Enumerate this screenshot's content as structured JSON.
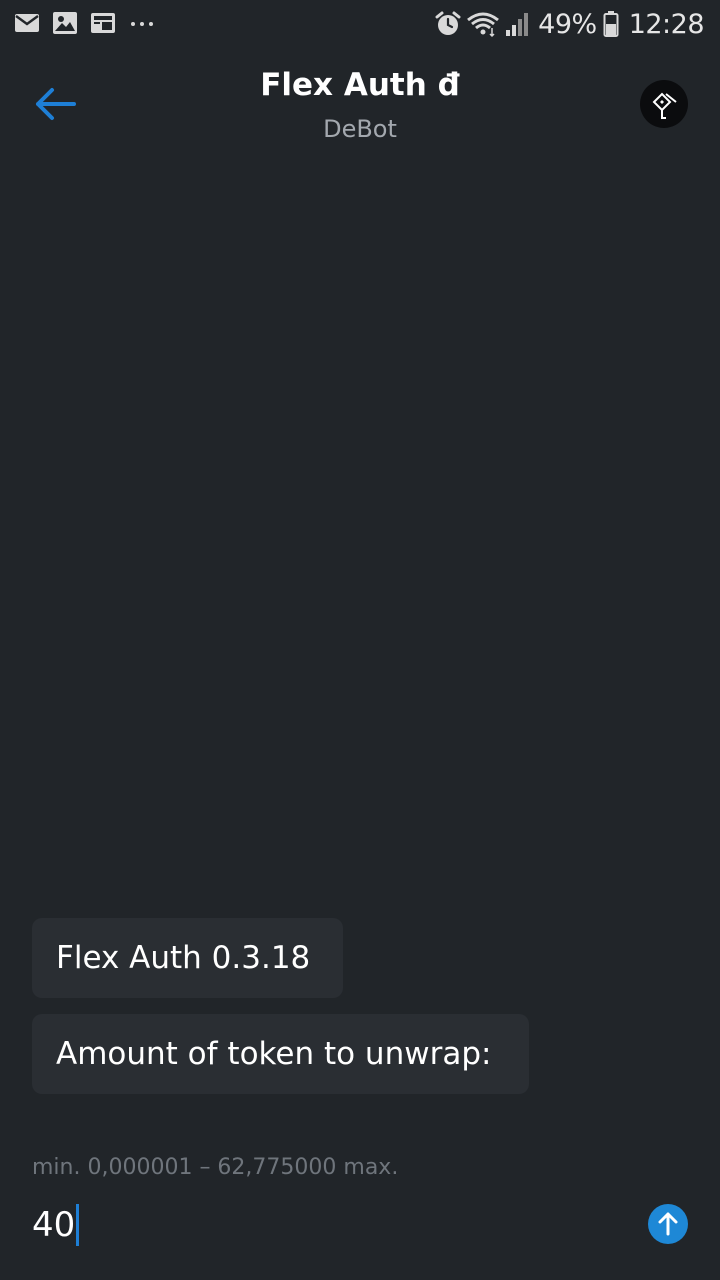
{
  "status_bar": {
    "left_icons": [
      "mail-icon",
      "image-icon",
      "news-icon",
      "more-dots-icon"
    ],
    "right_icons": [
      "alarm-icon",
      "wifi-icon",
      "signal-icon",
      "battery-icon"
    ],
    "battery_percent": "49%",
    "time": "12:28"
  },
  "header": {
    "title": "Flex Auth đ",
    "subtitle": "DeBot",
    "back_icon": "arrow-left-icon",
    "avatar_icon": "debot-avatar-icon"
  },
  "messages": [
    {
      "text": "Flex Auth 0.3.18"
    },
    {
      "text": "Amount of token to unwrap:"
    }
  ],
  "input": {
    "hint": "min. 0,000001 – 62,775000 max.",
    "value": "40",
    "send_icon": "arrow-up-icon"
  },
  "colors": {
    "background": "#212529",
    "bubble": "#2a2e33",
    "accent": "#1e88d6",
    "subtitle": "#a3a8ae",
    "hint": "#6f757c"
  }
}
